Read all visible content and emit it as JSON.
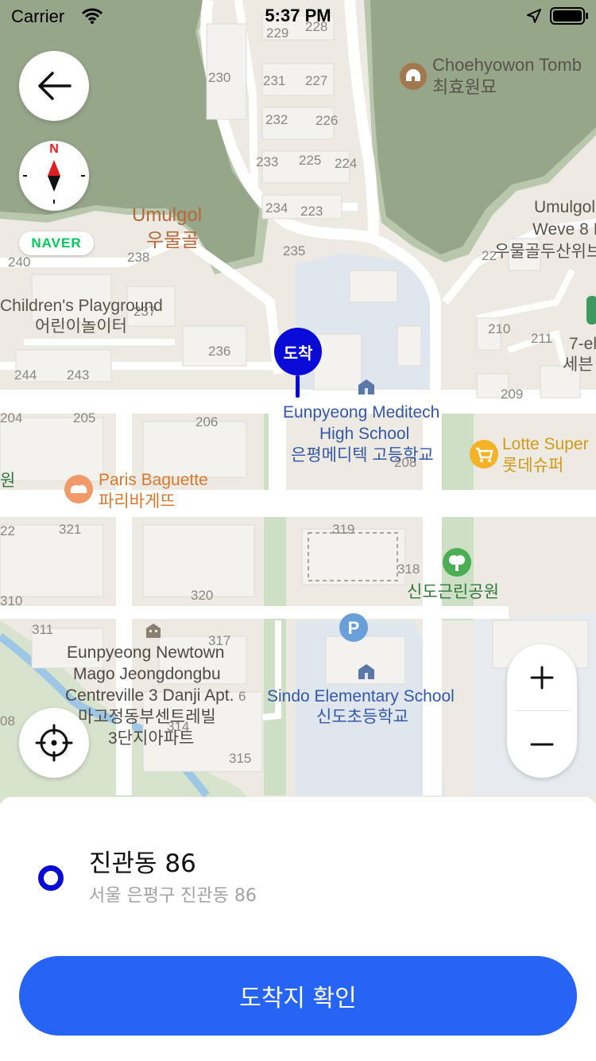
{
  "status_bar": {
    "carrier": "Carrier",
    "time": "5:37 PM"
  },
  "map": {
    "naver_badge": "NAVER",
    "compass_letter": "N",
    "pin_label": "도착",
    "pois": {
      "choehyowon_en": "Choehyowon Tomb",
      "choehyowon_ko": "최효원묘",
      "umulgol_en": "Umulgol",
      "umulgol_ko": "우물골",
      "playground_en": "Children's Playground",
      "playground_ko": "어린이놀이터",
      "umulgol_weve_en1": "Umulgol",
      "umulgol_weve_en2": "Weve 8 I",
      "umulgol_weve_ko": "우물골두산위브",
      "seven_eleven_en": "7-el",
      "seven_eleven_ko": "세븐",
      "meditech_en1": "Eunpyeong Meditech",
      "meditech_en2": "High School",
      "meditech_ko": "은평메디텍 고등학교",
      "lotte_en": "Lotte Super",
      "lotte_ko": "롯데슈퍼",
      "paris_en": "Paris Baguette",
      "paris_ko": "파리바게뜨",
      "park_partial": "원",
      "sindo_park_ko": "신도근린공원",
      "newtown_en1": "Eunpyeong Newtown",
      "newtown_en2": "Mago Jeongdongbu",
      "newtown_en3": "Centreville 3 Danji Apt.",
      "newtown_ko1": "마고정동부센트레빌",
      "newtown_ko2": "3단지아파트",
      "sindo_school_en": "Sindo Elementary School",
      "sindo_school_ko": "신도초등학교"
    },
    "block_numbers": {
      "n229": "229",
      "n228": "228",
      "n230": "230",
      "n231": "231",
      "n227": "227",
      "n232": "232",
      "n226": "226",
      "n233": "233",
      "n225": "225",
      "n224": "224",
      "n234": "234",
      "n223": "223",
      "n235": "235",
      "n238": "238",
      "n240": "240",
      "n237": "237",
      "n236": "236",
      "n244": "244",
      "n243": "243",
      "n204": "204",
      "n205": "205",
      "n206": "206",
      "n210": "210",
      "n211": "211",
      "n209": "209",
      "n22x": "22",
      "n321": "321",
      "n22l": "22",
      "n319": "319",
      "n318": "318",
      "n320": "320",
      "n310": "310",
      "n311": "311",
      "n317": "317",
      "n316": "6",
      "n308": "08",
      "n314": "314",
      "n315": "315",
      "n208": "208"
    },
    "accent_color": "#0a0ad6"
  },
  "destination": {
    "title": "진관동 86",
    "address": "서울 은평구 진관동 86",
    "confirm_label": "도착지 확인",
    "button_color": "#2664f5"
  }
}
